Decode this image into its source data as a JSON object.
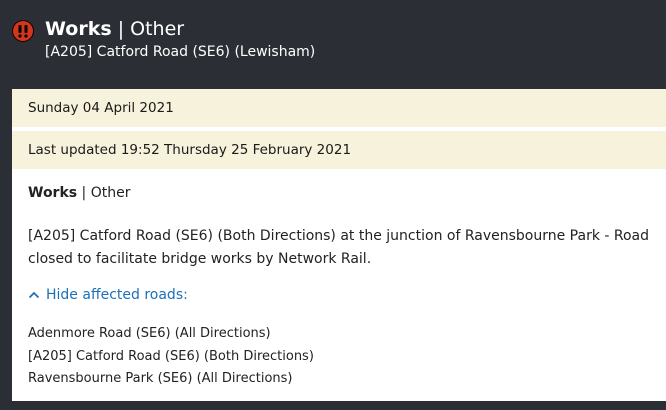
{
  "header": {
    "icon": "alert-double-exclamation-icon",
    "title_bold": "Works",
    "title_separator": " | ",
    "title_category": "Other",
    "subtitle": "[A205] Catford Road (SE6) (Lewisham)"
  },
  "dates": {
    "date": "Sunday 04 April 2021",
    "last_updated": "Last updated 19:52 Thursday 25 February 2021"
  },
  "detail": {
    "type": "Works",
    "separator": " | ",
    "category": "Other",
    "description_line1": "[A205] Catford Road (SE6) (Both Directions) at the junction of Ravensbourne Park - Road",
    "description_line2": "closed to facilitate bridge works by Network Rail.",
    "toggle_label": "Hide affected roads:",
    "toggle_icon": "chevron-up-icon",
    "affected_roads": [
      "Adenmore Road (SE6) (All Directions)",
      "[A205] Catford Road (SE6) (Both Directions)",
      "Ravensbourne Park (SE6) (All Directions)"
    ]
  },
  "colors": {
    "background": "#2b2e35",
    "alert": "#d4351c",
    "band": "#f7f2dc",
    "link": "#1d70b8"
  }
}
